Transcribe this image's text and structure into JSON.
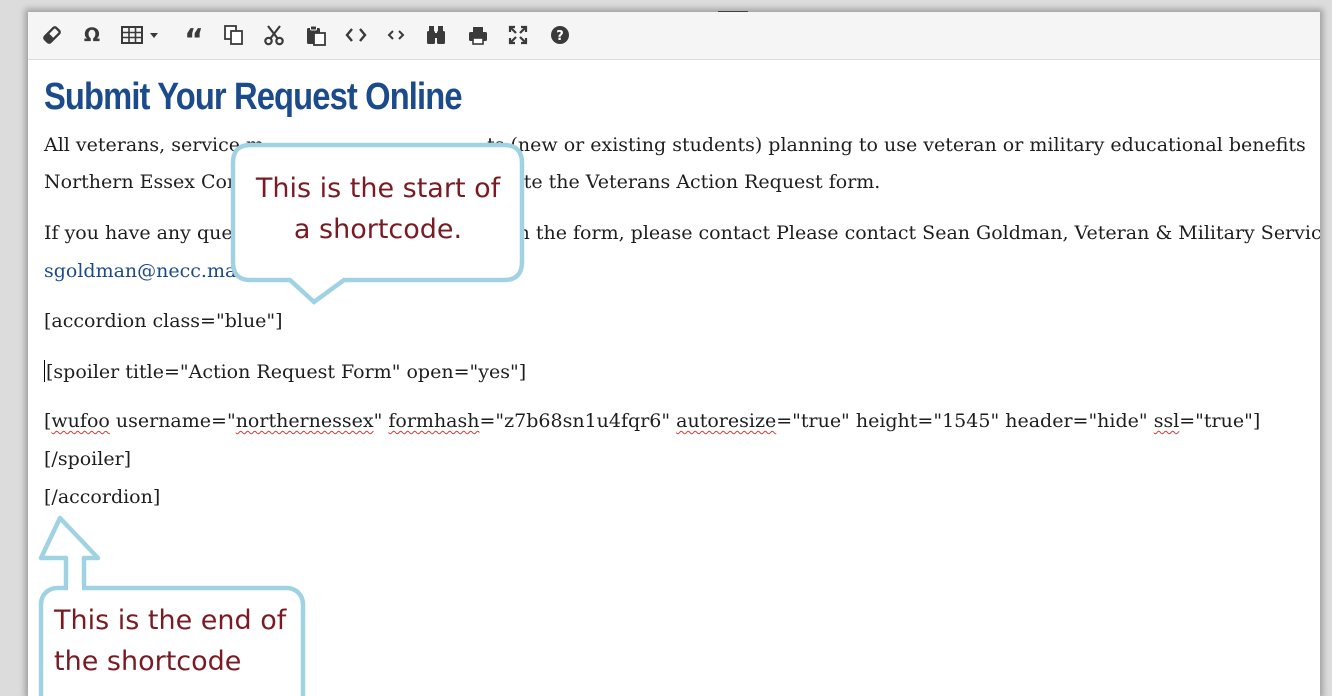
{
  "toolbar": {
    "buttons": [
      {
        "name": "eraser-icon"
      },
      {
        "name": "omega-icon",
        "glyph": "Ω"
      },
      {
        "name": "table-icon"
      },
      {
        "name": "blockquote-icon",
        "glyph": "“"
      },
      {
        "name": "copy-icon"
      },
      {
        "name": "cut-icon"
      },
      {
        "name": "paste-icon"
      },
      {
        "name": "code-icon",
        "glyph": "<>"
      },
      {
        "name": "inline-code-icon",
        "glyph": "‹›"
      },
      {
        "name": "binoculars-icon"
      },
      {
        "name": "print-icon"
      },
      {
        "name": "fullscreen-icon"
      },
      {
        "name": "help-icon",
        "glyph": "?"
      }
    ]
  },
  "content": {
    "title": "Submit Your Request Online",
    "para1_line1_a": "All veterans, service m",
    "para1_line1_b": "ts (new or existing students) planning to use veteran or military educational benefits",
    "para1_line2_a": "Northern Essex Con",
    "para1_line2_b": "plete the Veterans Action Request form.",
    "para2_line1_a": "If you have any que",
    "para2_line1_b": "n the form, please contact Please contact Sean Goldman, Veteran & Military Servic",
    "email": "sgoldman@necc.ma",
    "accordion_open": "[accordion class=\"blue\"]",
    "spoiler_open": "[spoiler title=\"Action Request Form\" open=\"yes\"]",
    "wufoo_1": "[",
    "wufoo_word": "wufoo",
    "wufoo_2": " username=\"",
    "wufoo_user": "northernessex",
    "wufoo_3": "\" ",
    "wufoo_formhash": "formhash",
    "wufoo_4": "=\"z7b68sn1u4fqr6\" ",
    "wufoo_autoresize": "autoresize",
    "wufoo_5": "=\"true\" height=\"1545\" header=\"hide\" ",
    "wufoo_ssl": "ssl",
    "wufoo_6": "=\"true\"]",
    "spoiler_close": "[/spoiler]",
    "accordion_close": "[/accordion]"
  },
  "callouts": {
    "start_line1": "This is the start of",
    "start_line2": "a shortcode.",
    "end_line1": "This is the end of",
    "end_line2": "the shortcode"
  },
  "colors": {
    "title": "#1b4b8a",
    "callout_border": "#9fd3e3",
    "callout_text": "#7a1a22"
  }
}
